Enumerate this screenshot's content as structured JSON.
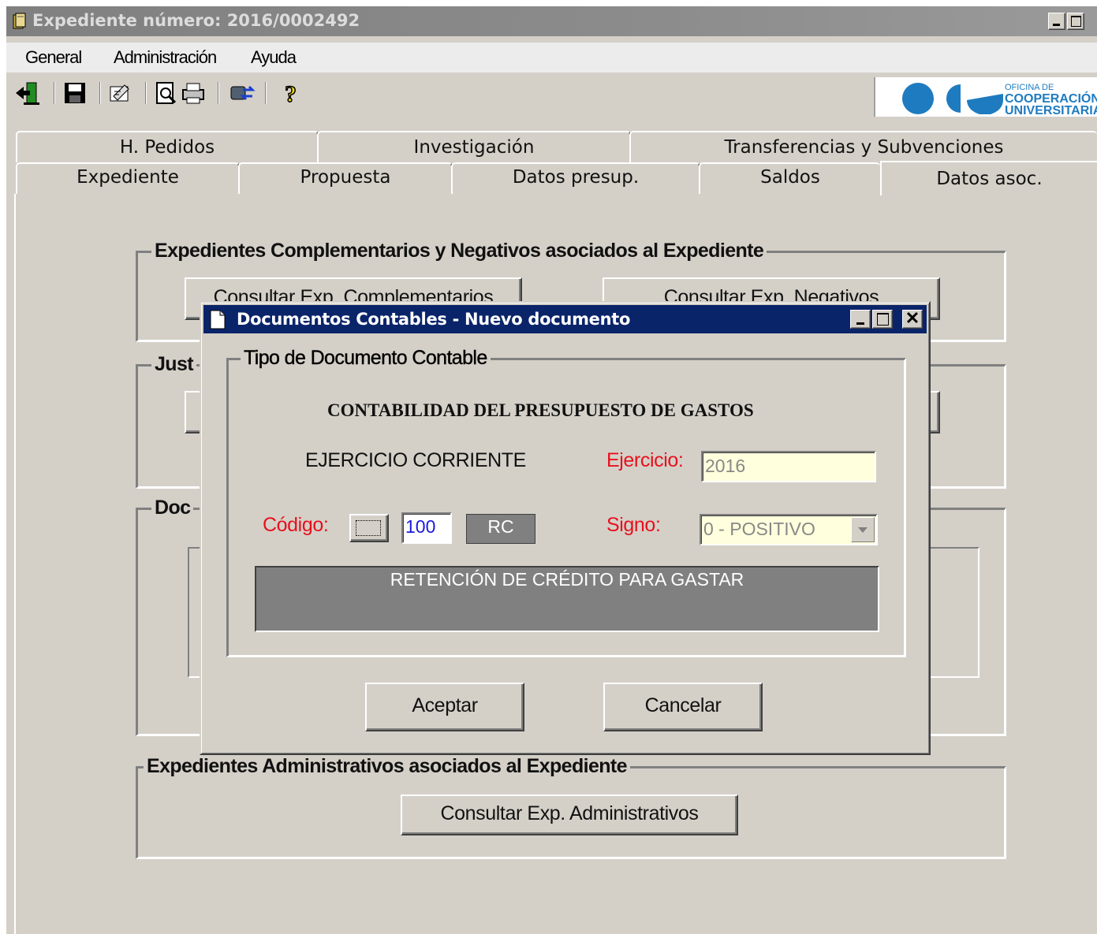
{
  "window": {
    "title": "Expediente número: 2016/0002492"
  },
  "menu": [
    "General",
    "Administración",
    "Ayuda"
  ],
  "toolbar": [
    "exit-icon",
    "save-icon",
    "edit-icon",
    "preview-icon",
    "print-icon",
    "transfer-icon",
    "help-icon"
  ],
  "logo": {
    "line1": "OFICINA DE",
    "line2": "COOPERACIÓN",
    "line3": "UNIVERSITARIA"
  },
  "tabs": {
    "back_row": [
      "H. Pedidos",
      "Investigación",
      "Transferencias y Subvenciones"
    ],
    "front_row": [
      "Expediente",
      "Propuesta",
      "Datos presup.",
      "Saldos",
      "Datos asoc."
    ],
    "active": "Datos asoc."
  },
  "groups": {
    "complementarios": {
      "legend": "Expedientes Complementarios y Negativos asociados al Expediente",
      "btn_complementarios": "Consultar Exp. Complementarios",
      "btn_negativos": "Consultar Exp. Negativos"
    },
    "justificacion": {
      "legend": "Just"
    },
    "documentos": {
      "legend": "Doc"
    },
    "administrativos": {
      "legend": "Expedientes Administrativos asociados al Expediente",
      "btn": "Consultar Exp. Administrativos"
    }
  },
  "dialog": {
    "title": "Documentos Contables - Nuevo documento",
    "group_legend": "Tipo de Documento Contable",
    "heading": "CONTABILIDAD DEL PRESUPUESTO DE GASTOS",
    "ejercicio_tipo": "EJERCICIO CORRIENTE",
    "ejercicio_label": "Ejercicio:",
    "ejercicio_value": "2016",
    "codigo_label": "Código:",
    "codigo_value": "100",
    "codigo_abbr": "RC",
    "signo_label": "Signo:",
    "signo_value": "0 - POSITIVO",
    "description": "RETENCIÓN DE CRÉDITO PARA GASTAR",
    "accept": "Aceptar",
    "cancel": "Cancelar"
  },
  "colors": {
    "dialog_title": "#0a246a",
    "required_label": "#e8101c",
    "readonly_field": "#ffffdd",
    "code_value": "#1a1ae0"
  }
}
